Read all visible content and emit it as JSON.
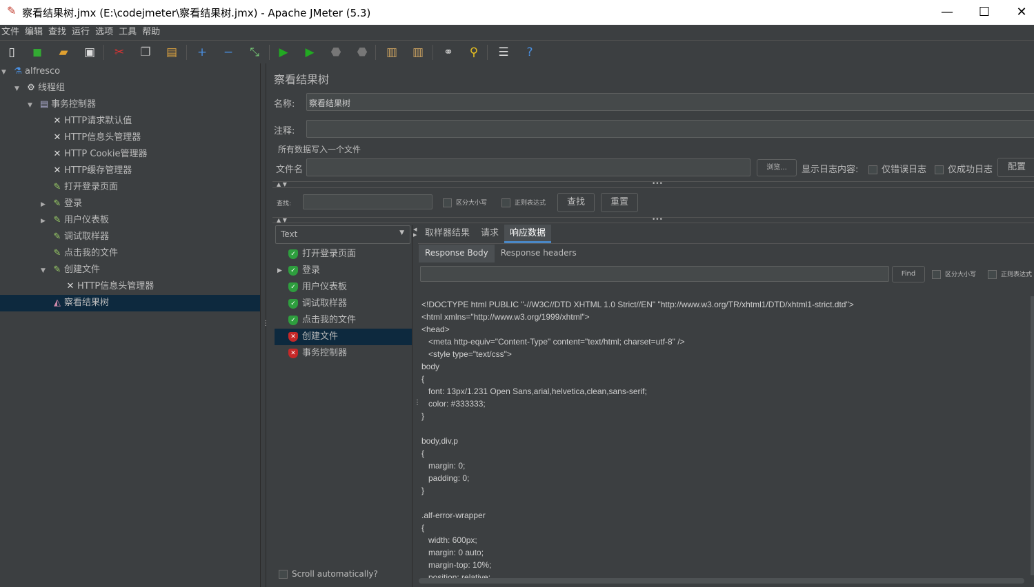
{
  "window": {
    "title": "察看结果树.jmx (E:\\codejmeter\\察看结果树.jmx) - Apache JMeter (5.3)",
    "minimize": "—",
    "maximize": "☐",
    "close": "✕"
  },
  "menu": [
    "文件",
    "编辑",
    "查找",
    "运行",
    "选项",
    "工具",
    "帮助"
  ],
  "toolbar": [
    {
      "icon": "new-icon",
      "g": "▯",
      "c": "#eee"
    },
    {
      "icon": "templates-icon",
      "g": "◼",
      "c": "#3a3"
    },
    {
      "icon": "open-icon",
      "g": "▰",
      "c": "#e0a030"
    },
    {
      "icon": "save-icon",
      "g": "▣",
      "c": "#ddd"
    },
    {
      "icon": "cut-icon",
      "g": "✂",
      "c": "#d33"
    },
    {
      "icon": "copy-icon",
      "g": "❐",
      "c": "#bbb"
    },
    {
      "icon": "paste-icon",
      "g": "▤",
      "c": "#d9a040"
    },
    {
      "icon": "expand-icon",
      "g": "+",
      "c": "#4a90e2"
    },
    {
      "icon": "collapse-icon",
      "g": "−",
      "c": "#4a90e2"
    },
    {
      "icon": "toggle-icon",
      "g": "⤡",
      "c": "#7c7"
    },
    {
      "icon": "start-icon",
      "g": "▶",
      "c": "#2a2"
    },
    {
      "icon": "start-no-pause-icon",
      "g": "▶",
      "c": "#2a2"
    },
    {
      "icon": "stop-icon",
      "g": "⬣",
      "c": "#777"
    },
    {
      "icon": "shutdown-icon",
      "g": "⬣",
      "c": "#777"
    },
    {
      "icon": "clear-icon",
      "g": "▥",
      "c": "#c9a060"
    },
    {
      "icon": "clear-all-icon",
      "g": "▥",
      "c": "#c9a060"
    },
    {
      "icon": "search-icon",
      "g": "⚭",
      "c": "#ccc"
    },
    {
      "icon": "reset-search-icon",
      "g": "⚲",
      "c": "#e8c020"
    },
    {
      "icon": "function-helper-icon",
      "g": "☰",
      "c": "#ddd"
    },
    {
      "icon": "help-icon",
      "g": "?",
      "c": "#4a90e2"
    }
  ],
  "tree": [
    {
      "label": "alfresco",
      "icon": "test-plan-icon",
      "level": 0,
      "arrow": "▼"
    },
    {
      "label": "线程组",
      "icon": "gear-icon",
      "level": 1,
      "arrow": "▼"
    },
    {
      "label": "事务控制器",
      "icon": "controller-icon",
      "level": 2,
      "arrow": "▼"
    },
    {
      "label": "HTTP请求默认值",
      "icon": "config-icon",
      "level": 3,
      "arrow": ""
    },
    {
      "label": "HTTP信息头管理器",
      "icon": "config-icon",
      "level": 3,
      "arrow": ""
    },
    {
      "label": "HTTP Cookie管理器",
      "icon": "config-icon",
      "level": 3,
      "arrow": ""
    },
    {
      "label": "HTTP缓存管理器",
      "icon": "config-icon",
      "level": 3,
      "arrow": ""
    },
    {
      "label": "打开登录页面",
      "icon": "sampler-icon",
      "level": 3,
      "arrow": ""
    },
    {
      "label": "登录",
      "icon": "sampler-icon",
      "level": 3,
      "arrow": "▶"
    },
    {
      "label": "用户仪表板",
      "icon": "sampler-icon",
      "level": 3,
      "arrow": "▶"
    },
    {
      "label": "调试取样器",
      "icon": "sampler-icon",
      "level": 3,
      "arrow": ""
    },
    {
      "label": "点击我的文件",
      "icon": "sampler-icon",
      "level": 3,
      "arrow": ""
    },
    {
      "label": "创建文件",
      "icon": "sampler-icon",
      "level": 3,
      "arrow": "▼"
    },
    {
      "label": "HTTP信息头管理器",
      "icon": "config-icon",
      "level": 4,
      "arrow": ""
    },
    {
      "label": "察看结果树",
      "icon": "listener-icon",
      "level": 3,
      "arrow": "",
      "selected": true
    }
  ],
  "panel": {
    "title": "察看结果树",
    "name_label": "名称:",
    "name_value": "察看结果树",
    "comment_label": "注释:",
    "comment_value": "",
    "file_section": "所有数据写入一个文件",
    "file_label": "文件名",
    "file_value": "",
    "browse": "浏览...",
    "log_label": "显示日志内容:",
    "errors_only": "仅错误日志",
    "success_only": "仅成功日志",
    "configure": "配置",
    "search_label": "查找:",
    "search_value": "",
    "case_sensitive": "区分大小写",
    "regex": "正则表达式",
    "find_button": "查找",
    "reset_button": "重置",
    "renderer": "Text",
    "results": [
      {
        "label": "打开登录页面",
        "status": "success",
        "arrow": ""
      },
      {
        "label": "登录",
        "status": "success",
        "arrow": "▶"
      },
      {
        "label": "用户仪表板",
        "status": "success",
        "arrow": ""
      },
      {
        "label": "调试取样器",
        "status": "success",
        "arrow": ""
      },
      {
        "label": "点击我的文件",
        "status": "success",
        "arrow": ""
      },
      {
        "label": "创建文件",
        "status": "error",
        "arrow": "",
        "selected": true
      },
      {
        "label": "事务控制器",
        "status": "error",
        "arrow": ""
      }
    ],
    "scroll_auto": "Scroll automatically?",
    "tabs": [
      "取样器结果",
      "请求",
      "响应数据"
    ],
    "active_tab": 2,
    "subtabs": [
      "Response Body",
      "Response headers"
    ],
    "find_value": "",
    "find": "Find",
    "find_case": "区分大小写",
    "find_regex": "正则表达式",
    "body_lines": [
      "<!DOCTYPE html PUBLIC \"-//W3C//DTD XHTML 1.0 Strict//EN\" \"http://www.w3.org/TR/xhtml1/DTD/xhtml1-strict.dtd\">",
      "<html xmlns=\"http://www.w3.org/1999/xhtml\">",
      "<head>",
      "   <meta http-equiv=\"Content-Type\" content=\"text/html; charset=utf-8\" />",
      "   <style type=\"text/css\">",
      "body",
      "{",
      "   font: 13px/1.231 Open Sans,arial,helvetica,clean,sans-serif;",
      "   color: #333333;",
      "}",
      "",
      "body,div,p",
      "{",
      "   margin: 0;",
      "   padding: 0;",
      "}",
      "",
      ".alf-error-wrapper",
      "{",
      "   width: 600px;",
      "   margin: 0 auto;",
      "   margin-top: 10%;",
      "   position: relative;"
    ]
  },
  "colors": {
    "bg": "#3c3f41",
    "selection": "#0d293e",
    "success": "#2e9e3e",
    "error": "#c62828",
    "accent": "#4a88c7"
  }
}
